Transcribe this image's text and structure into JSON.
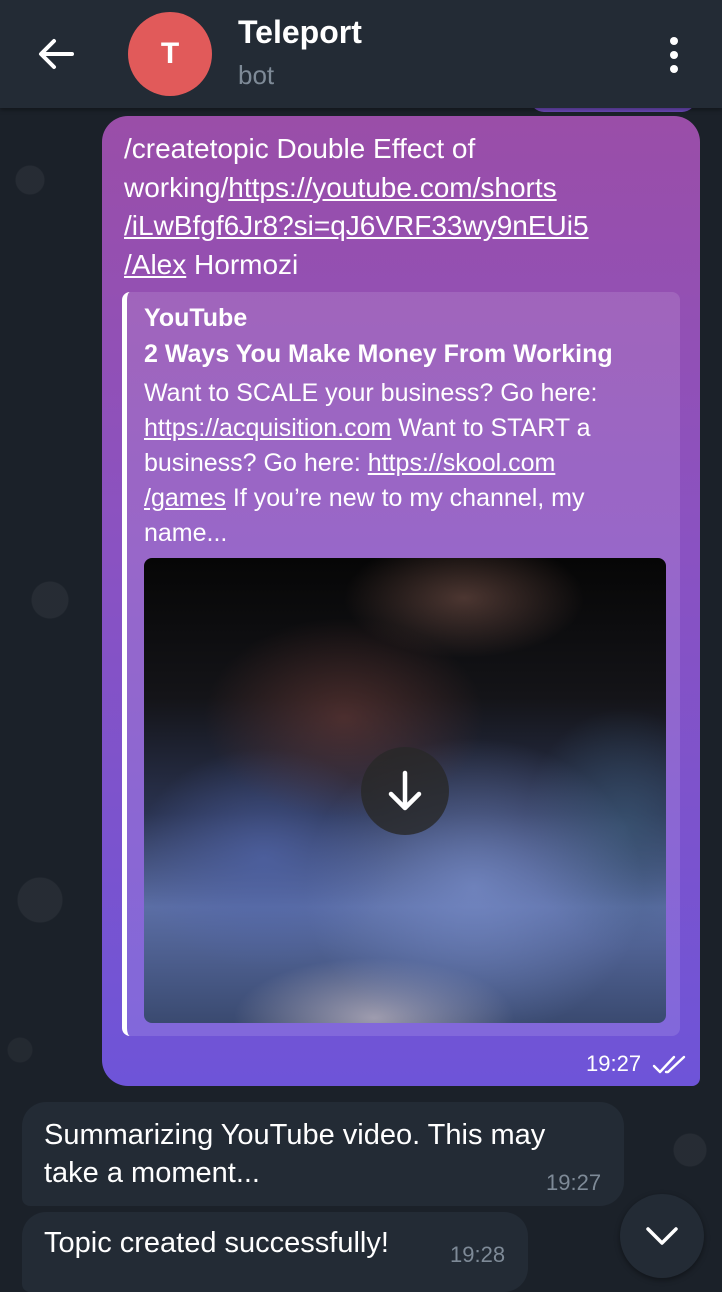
{
  "header": {
    "avatar_letter": "T",
    "title": "Teleport",
    "subtitle": "bot"
  },
  "outgoing": {
    "text_parts": [
      "/createtopic Double Effect of working/",
      "https://youtube.com/shorts/iLwBfgf6Jr8?si=qJ6VRF33wy9nEUi5/Alex",
      " Hormozi"
    ],
    "link_lines": [
      "https://youtube.com/shorts",
      "/iLwBfgf6Jr8?si=qJ6VRF33wy9nEUi5",
      "/Alex"
    ],
    "time": "19:27",
    "status": "read"
  },
  "preview": {
    "site": "YouTube",
    "title": "2 Ways You Make Money From Working",
    "desc_1": "Want to SCALE your business? Go here: ",
    "desc_link_1": "https://acquisition.com",
    "desc_2": " Want to START a business? Go here: ",
    "desc_link_2a": "https://skool.com",
    "desc_link_2b": "/games",
    "desc_3": " If you’re new to my channel, my name..."
  },
  "incoming": [
    {
      "text": "Summarizing YouTube video. This may take a moment...",
      "time": "19:27"
    },
    {
      "text": "Topic created successfully!",
      "time": "19:28"
    }
  ],
  "colors": {
    "header_bg": "#232b35",
    "chat_bg": "#1b2129",
    "outgoing_top": "#9a4ea8",
    "outgoing_bottom": "#6e54d8",
    "incoming_bg": "#232b35",
    "avatar": "#e15a5a",
    "muted_text": "#7e8a97"
  }
}
